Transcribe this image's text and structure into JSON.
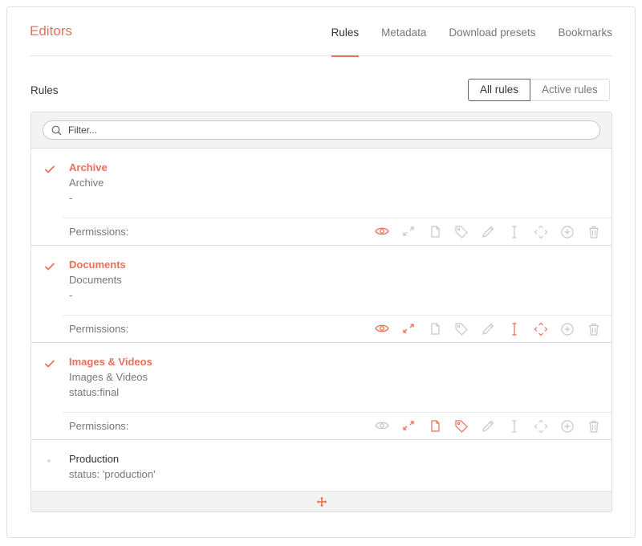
{
  "header": {
    "title": "Editors",
    "tabs": [
      {
        "label": "Rules",
        "active": true
      },
      {
        "label": "Metadata",
        "active": false
      },
      {
        "label": "Download presets",
        "active": false
      },
      {
        "label": "Bookmarks",
        "active": false
      }
    ]
  },
  "rules_section": {
    "title": "Rules",
    "toggle": {
      "all_label": "All rules",
      "active_label": "Active rules",
      "selected": "All rules"
    },
    "filter": {
      "placeholder": "Filter...",
      "value": ""
    },
    "permissions_label": "Permissions:",
    "permission_icons": [
      "eye-icon",
      "expand-icon",
      "file-icon",
      "tag-icon",
      "pencil-icon",
      "text-cursor-icon",
      "move-icon",
      "plus-circle-icon",
      "trash-icon"
    ],
    "rules": [
      {
        "name": "Archive",
        "description": "Archive",
        "query": "-",
        "checked": true,
        "permissions": {
          "view": true,
          "expand": false,
          "file": false,
          "tag": false,
          "edit": false,
          "text": false,
          "move": false,
          "add": false,
          "delete": false
        }
      },
      {
        "name": "Documents",
        "description": "Documents",
        "query": "-",
        "checked": true,
        "permissions": {
          "view": true,
          "expand": true,
          "file": false,
          "tag": false,
          "edit": false,
          "text": true,
          "move": true,
          "add": false,
          "delete": false
        }
      },
      {
        "name": "Images & Videos",
        "description": "Images & Videos",
        "query": "status:final",
        "checked": true,
        "permissions": {
          "view": false,
          "expand": true,
          "file": true,
          "tag": true,
          "edit": false,
          "text": false,
          "move": false,
          "add": false,
          "delete": false
        }
      },
      {
        "name": "Production",
        "description": "status: 'production'",
        "checked": false
      }
    ]
  },
  "colors": {
    "accent": "#e8705a",
    "muted_icon": "#c8c8c8",
    "border": "#dddddd",
    "bar_bg": "#f3f3f3"
  }
}
